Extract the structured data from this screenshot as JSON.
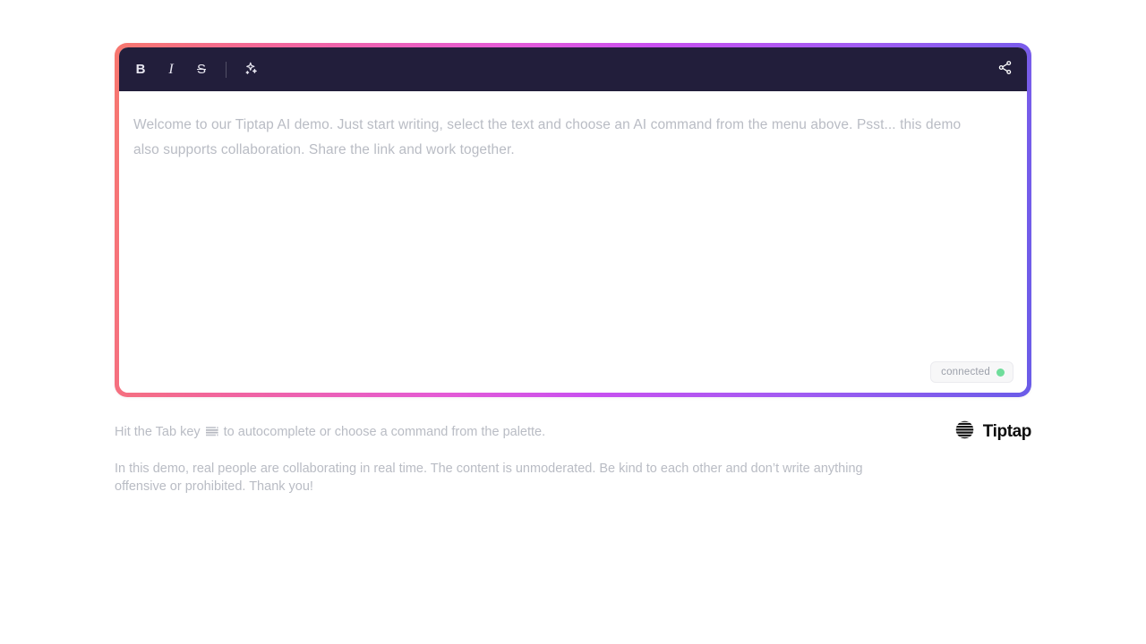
{
  "theme": {
    "gradient_start": "#f7776e",
    "gradient_mid": "#c850f0",
    "gradient_end": "#6a5ce8",
    "toolbar_bg": "#221e3b",
    "editor_bg": "#ffffff",
    "muted_text": "#b9bcc4",
    "status_green": "#6fdd9b",
    "brand_black": "#0d0d0d"
  },
  "toolbar": {
    "bold": {
      "label": "B",
      "icon": "bold-icon",
      "title": "Bold"
    },
    "italic": {
      "label": "I",
      "icon": "italic-icon",
      "title": "Italic"
    },
    "strike": {
      "label": "S",
      "icon": "strikethrough-icon",
      "title": "Strikethrough"
    },
    "ai": {
      "icon": "sparkles-ai-icon",
      "title": "AI"
    },
    "share": {
      "icon": "share-icon",
      "title": "Share"
    }
  },
  "editor": {
    "paragraph": "Welcome to our Tiptap AI demo. Just start writing, select the text and choose an AI command from the menu above. Psst... this demo also supports collaboration. Share the link and work together.",
    "status": {
      "label": "connected",
      "dot_color": "#6fdd9b"
    }
  },
  "footer": {
    "hint_before": "Hit the Tab key",
    "hint_after": "to autocomplete or choose a command from the palette.",
    "tab_key_icon": "tab-key-icon",
    "brand": {
      "logo_icon": "tiptap-logo-icon",
      "name": "Tiptap"
    },
    "disclaimer": "In this demo, real people are collaborating in real time. The content is unmoderated. Be kind to each other and don’t write anything offensive or prohibited. Thank you!"
  }
}
